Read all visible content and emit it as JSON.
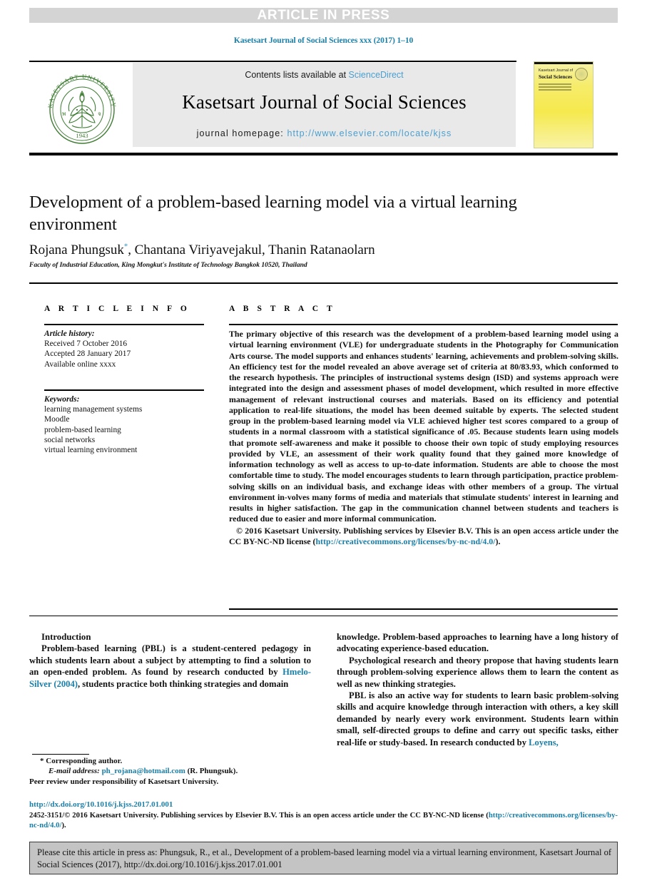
{
  "banner": {
    "label": "ARTICLE IN PRESS",
    "bar_color": "#d4d4d4",
    "text_color": "#ffffff"
  },
  "running_head": "Kasetsart Journal of Social Sciences xxx (2017) 1–10",
  "masthead": {
    "contents_prefix": "Contents lists available at ",
    "contents_link": "ScienceDirect",
    "journal_title": "Kasetsart Journal of Social Sciences",
    "homepage_label": "journal homepage: ",
    "homepage_url": "http://www.elsevier.com/locate/kjss",
    "link_color": "#4a9fd0",
    "box_color": "#e9e9e9"
  },
  "seal": {
    "name": "kasetsart-university-seal",
    "outer_text": "KASETSART UNIVERSITY",
    "year": "1943",
    "color": "#3f7c33"
  },
  "cover": {
    "name": "journal-cover-thumbnail",
    "line1": "Kasetsart Journal of",
    "line2": "Social Sciences",
    "accent": "#f6e94e"
  },
  "article": {
    "title": "Development of a problem-based learning model via a virtual learning environment",
    "authors": "Rojana Phungsuk, Chantana Viriyavejakul, Thanin Ratanaolarn",
    "corresponding_marker": "*",
    "affiliation": "Faculty of Industrial Education, King Mongkut's Institute of Technology Bangkok 10520, Thailand"
  },
  "info": {
    "heading": "A R T I C L E   I N F O",
    "history_label": "Article history:",
    "history": [
      "Received 7 October 2016",
      "Accepted 28 January 2017",
      "Available online xxxx"
    ],
    "keywords_label": "Keywords:",
    "keywords": [
      "learning management systems",
      "Moodle",
      "problem-based learning",
      "social networks",
      "virtual learning environment"
    ]
  },
  "abstract": {
    "heading": "A B S T R A C T",
    "body": "The primary objective of this research was the development of a problem-based learning model using a virtual learning environment (VLE) for undergraduate students in the Photography for Communication Arts course. The model supports and enhances students' learning, achievements and problem-solving skills. An efficiency test for the model revealed an above average set of criteria at 80/83.93, which conformed to the research hypothesis. The principles of instructional systems design (ISD) and systems approach were integrated into the design and assessment phases of model development, which resulted in more effective management of relevant instructional courses and materials. Based on its efficiency and potential application to real-life situations, the model has been deemed suitable by experts. The selected student group in the problem-based learning model via VLE achieved higher test scores compared to a group of students in a normal classroom with a statistical significance of .05. Because students learn using models that promote self-awareness and make it possible to choose their own topic of study employing resources provided by VLE, an assessment of their work quality found that they gained more knowledge of information technology as well as access to up-to-date information. Students are able to choose the most comfortable time to study. The model encourages students to learn through participation, practice problem-solving skills on an individual basis, and exchange ideas with other members of a group. The virtual environment in-volves many forms of media and materials that stimulate students' interest in learning and results in higher satisfaction. The gap in the communication channel between students and teachers is reduced due to easier and more informal communication.",
    "copyright_prefix": "© 2016 Kasetsart University. Publishing services by Elsevier B.V. This is an open access article under the CC BY-NC-ND license (",
    "copyright_link": "http://creativecommons.org/licenses/by-nc-nd/4.0/",
    "copyright_suffix": ")."
  },
  "body": {
    "section_heading": "Introduction",
    "left_paragraph_1_a": "Problem-based learning (PBL) is a student-centered pedagogy in which students learn about a subject by attempting to find a solution to an open-ended problem. As found by research conducted by ",
    "left_citation_1": "Hmelo-Silver (2004)",
    "left_paragraph_1_b": ", students practice both thinking strategies and domain",
    "right_paragraph_1": "knowledge. Problem-based approaches to learning have a long history of advocating experience-based education.",
    "right_paragraph_2": "Psychological research and theory propose that having students learn through problem-solving experience allows them to learn the content as well as new thinking strategies.",
    "right_paragraph_3_a": "PBL is also an active way for students to learn basic problem-solving skills and acquire knowledge through interaction with others, a key skill demanded by nearly every work environment. Students learn within small, self-directed groups to define and carry out specific tasks, either real-life or study-based. In research conducted by ",
    "right_citation_1": "Loyens,"
  },
  "footnote": {
    "corresponding": "Corresponding author.",
    "email_label": "E-mail address:",
    "email": "ph_rojana@hotmail.com",
    "email_owner": "(R. Phungsuk).",
    "peer_review": "Peer review under responsibility of Kasetsart University."
  },
  "footer": {
    "doi": "http://dx.doi.org/10.1016/j.kjss.2017.01.001",
    "issn_prefix": "2452-3151/© 2016 Kasetsart University. Publishing services by Elsevier B.V. This is an open access article under the CC BY-NC-ND license (",
    "issn_link": "http://creativecommons.org/licenses/by-nc-nd/4.0/",
    "issn_suffix": ")."
  },
  "cite_box": {
    "text": "Please cite this article in press as: Phungsuk, R., et al., Development of a problem-based learning model via a virtual learning environment, Kasetsart Journal of Social Sciences (2017), http://dx.doi.org/10.1016/j.kjss.2017.01.001",
    "bg": "#c4c4c4"
  }
}
